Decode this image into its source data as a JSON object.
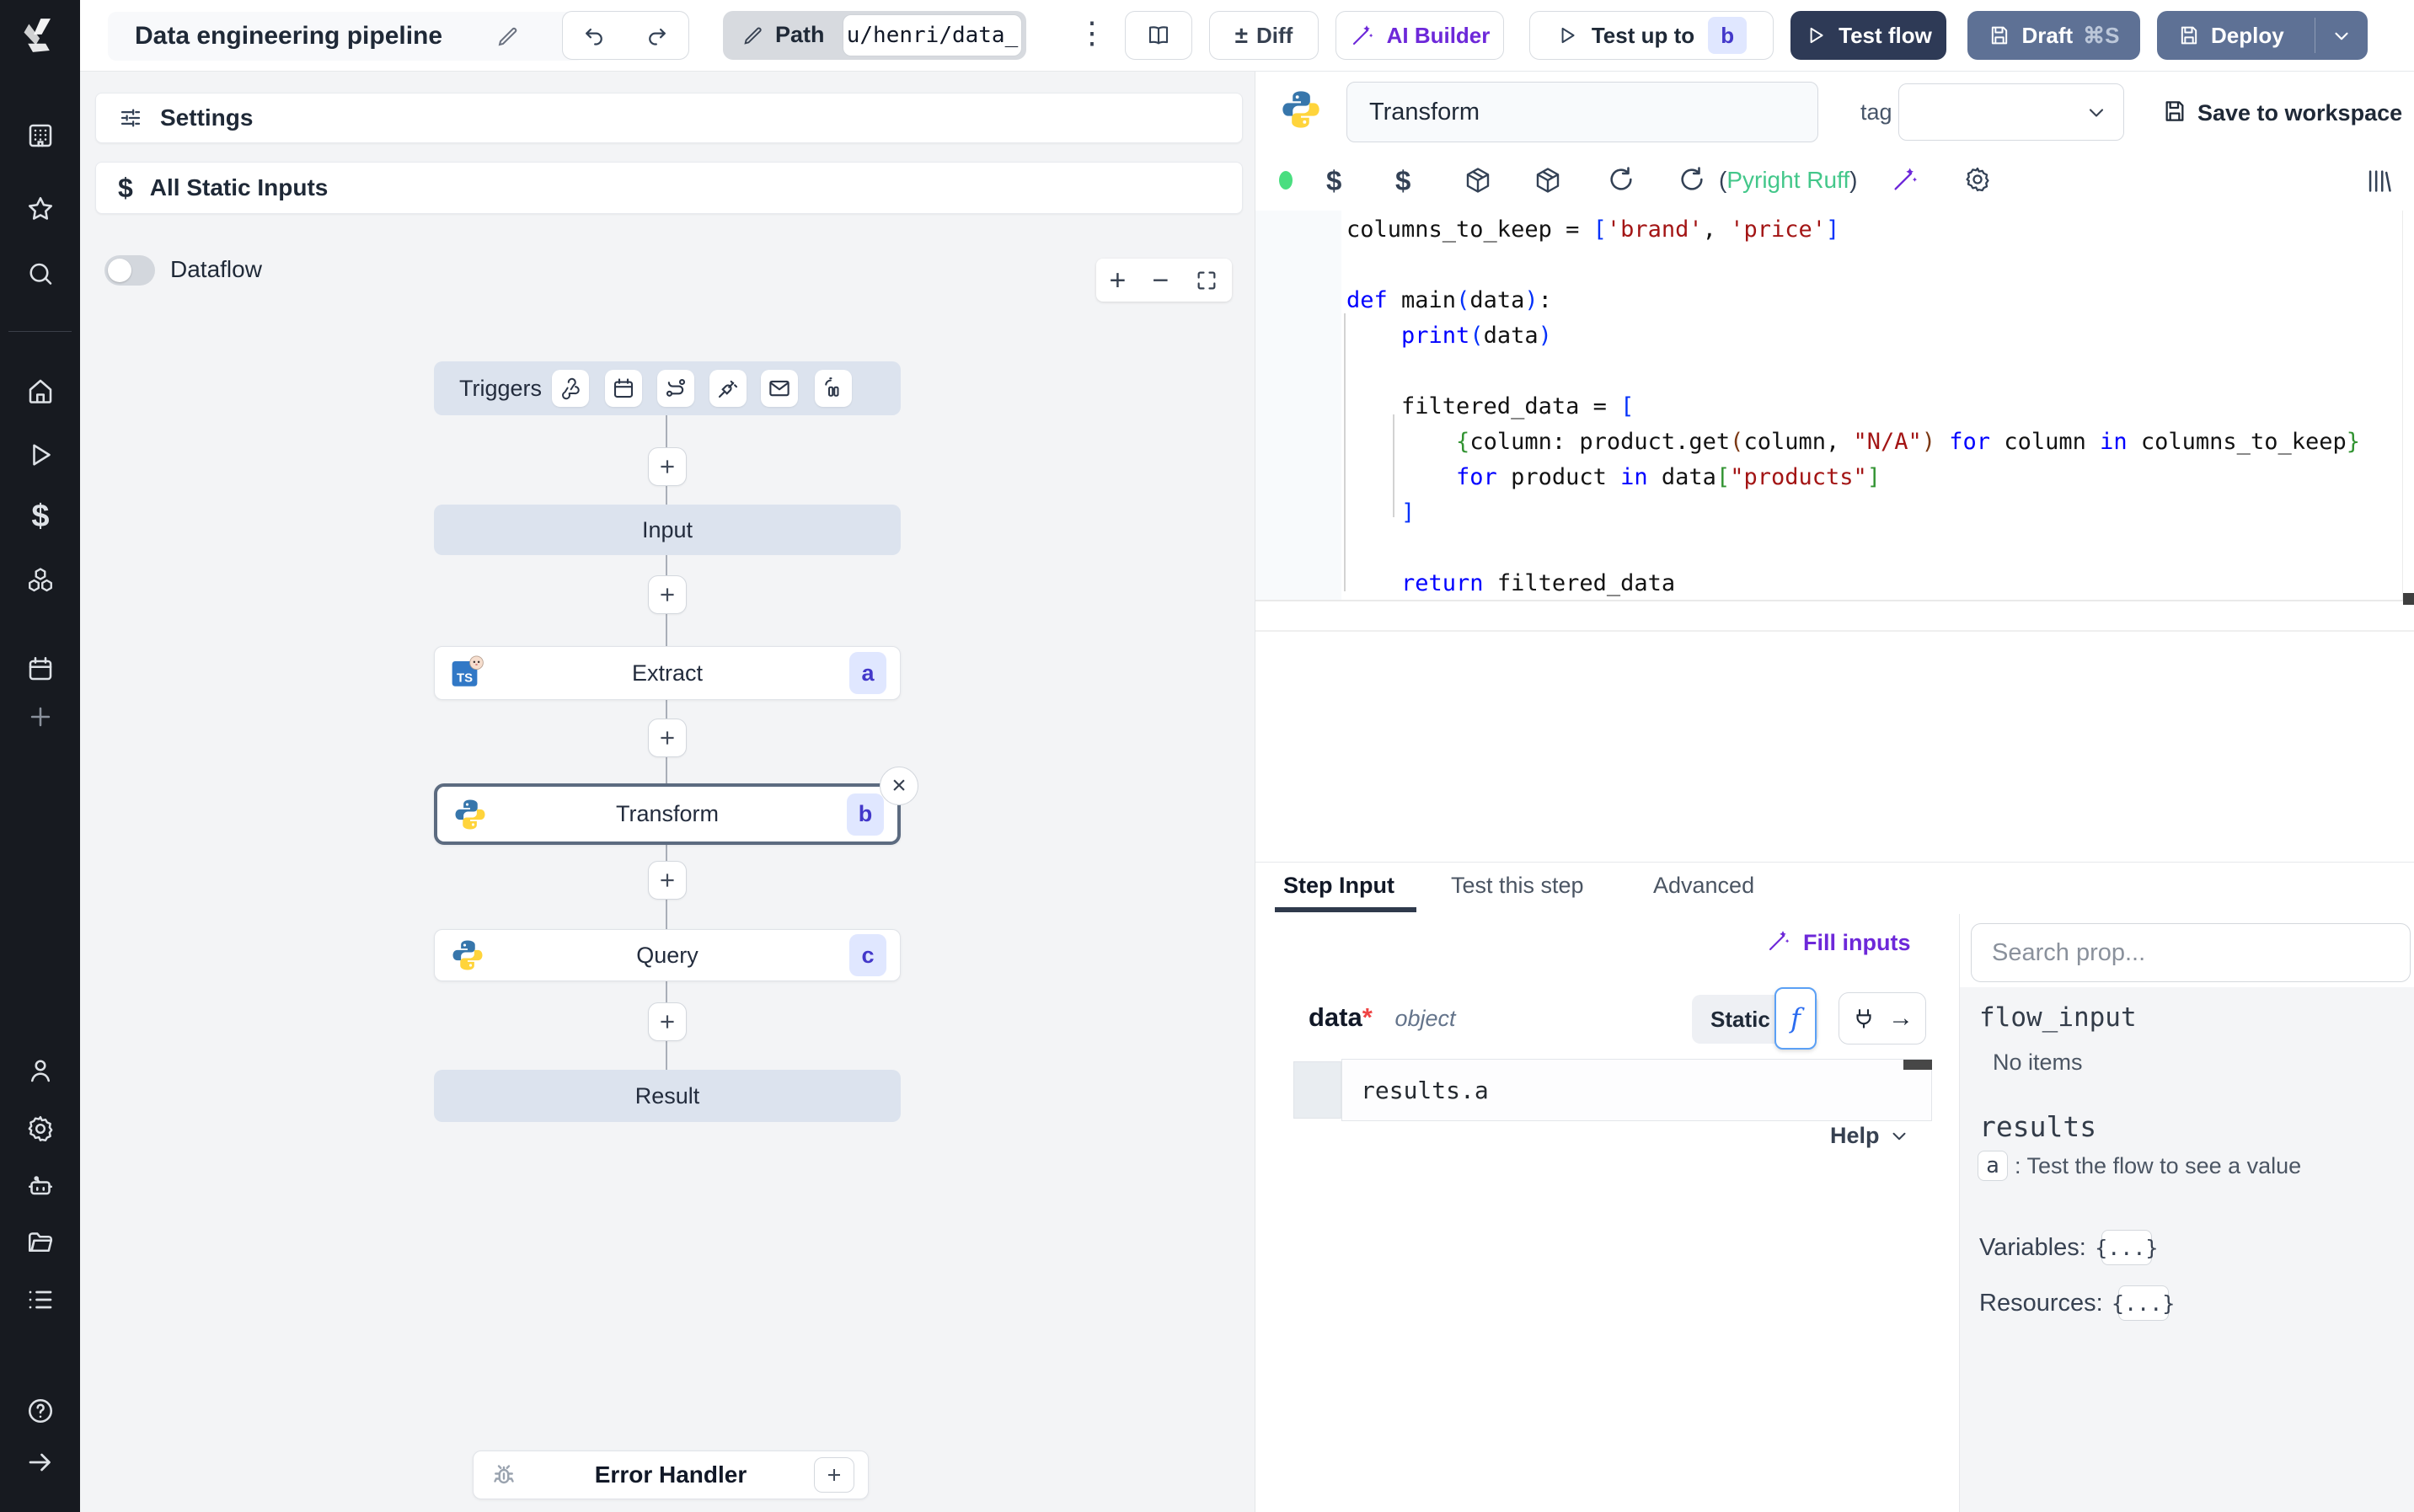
{
  "colors": {
    "accent_purple": "#6d28d9",
    "dark_button_bg": "#2e3a56",
    "slate_button_bg": "#5e7195",
    "status_green": "#4ade80",
    "lint_green": "#43c78a",
    "badge_bg": "#e0e7ff",
    "badge_text": "#4338ca",
    "selected_node_border": "#5c6b80",
    "virtual_node_bg": "#dce3ee",
    "code_keyword": "#0000ff",
    "code_string": "#a31515",
    "bracket_blue": "#0431fa",
    "bracket_green": "#319331",
    "bracket_brown": "#7b3814"
  },
  "glyphs": {
    "dollar": "$",
    "fn": "f",
    "plus": "+",
    "minus": "−",
    "plus_minus": "±",
    "close": "×",
    "kebab": "⋮",
    "arrow_right": "→"
  },
  "header": {
    "title": "Data engineering pipeline",
    "path_label": "Path",
    "path_value": "u/henri/data_",
    "diff_label": "Diff",
    "ai_builder_label": "AI Builder",
    "test_up_to_label": "Test up to",
    "test_up_to_badge": "b",
    "test_flow_label": "Test flow",
    "draft_label": "Draft",
    "draft_shortcut": "⌘S",
    "deploy_label": "Deploy"
  },
  "left_panel": {
    "settings_label": "Settings",
    "all_static_inputs_label": "All Static Inputs",
    "dataflow_label": "Dataflow"
  },
  "graph": {
    "triggers_label": "Triggers",
    "input_label": "Input",
    "extract": {
      "label": "Extract",
      "badge": "a"
    },
    "transform": {
      "label": "Transform",
      "badge": "b"
    },
    "query": {
      "label": "Query",
      "badge": "c"
    },
    "result_label": "Result",
    "error_handler_label": "Error Handler"
  },
  "editor_panel": {
    "step_name": "Transform",
    "tag_label": "tag",
    "save_to_workspace_label": "Save to workspace",
    "lint_open": "(",
    "lint_label": "Pyright Ruff",
    "lint_close": ")",
    "code_lines": [
      [
        {
          "c": "t",
          "t": "columns_to_keep = "
        },
        {
          "c": "b0",
          "t": "["
        },
        {
          "c": "s",
          "t": "'brand'"
        },
        {
          "c": "t",
          "t": ", "
        },
        {
          "c": "s",
          "t": "'price'"
        },
        {
          "c": "b0",
          "t": "]"
        }
      ],
      [],
      [
        {
          "c": "k",
          "t": "def"
        },
        {
          "c": "t",
          "t": " main"
        },
        {
          "c": "b0",
          "t": "("
        },
        {
          "c": "t",
          "t": "data"
        },
        {
          "c": "b0",
          "t": ")"
        },
        {
          "c": "t",
          "t": ":"
        }
      ],
      [
        {
          "c": "t",
          "t": "    "
        },
        {
          "c": "k",
          "t": "print"
        },
        {
          "c": "b0",
          "t": "("
        },
        {
          "c": "t",
          "t": "data"
        },
        {
          "c": "b0",
          "t": ")"
        }
      ],
      [],
      [
        {
          "c": "t",
          "t": "    filtered_data = "
        },
        {
          "c": "b0",
          "t": "["
        }
      ],
      [
        {
          "c": "t",
          "t": "        "
        },
        {
          "c": "b1",
          "t": "{"
        },
        {
          "c": "t",
          "t": "column: product.get"
        },
        {
          "c": "b2",
          "t": "("
        },
        {
          "c": "t",
          "t": "column, "
        },
        {
          "c": "s",
          "t": "\"N/A\""
        },
        {
          "c": "b2",
          "t": ")"
        },
        {
          "c": "t",
          "t": " "
        },
        {
          "c": "k",
          "t": "for"
        },
        {
          "c": "t",
          "t": " column "
        },
        {
          "c": "k",
          "t": "in"
        },
        {
          "c": "t",
          "t": " columns_to_keep"
        },
        {
          "c": "b1",
          "t": "}"
        }
      ],
      [
        {
          "c": "t",
          "t": "        "
        },
        {
          "c": "k",
          "t": "for"
        },
        {
          "c": "t",
          "t": " product "
        },
        {
          "c": "k",
          "t": "in"
        },
        {
          "c": "t",
          "t": " data"
        },
        {
          "c": "b1",
          "t": "["
        },
        {
          "c": "s",
          "t": "\"products\""
        },
        {
          "c": "b1",
          "t": "]"
        }
      ],
      [
        {
          "c": "t",
          "t": "    "
        },
        {
          "c": "b0",
          "t": "]"
        }
      ],
      [],
      [
        {
          "c": "t",
          "t": "    "
        },
        {
          "c": "k",
          "t": "return"
        },
        {
          "c": "t",
          "t": " filtered_data"
        }
      ]
    ]
  },
  "tabs": {
    "step_input": "Step Input",
    "test_this_step": "Test this step",
    "advanced": "Advanced"
  },
  "step_input": {
    "fill_inputs_label": "Fill inputs",
    "field_name": "data",
    "field_required_mark": "*",
    "field_type": "object",
    "static_label": "Static",
    "expression": "results.a",
    "help_label": "Help"
  },
  "props_panel": {
    "search_placeholder": "Search prop...",
    "flow_input_label": "flow_input",
    "no_items_label": "No items",
    "results_label": "results",
    "result_key": "a",
    "result_hint": ":  Test the flow to see a value",
    "variables_label": "Variables:",
    "variables_value": "{...}",
    "resources_label": "Resources:",
    "resources_value": "{...}"
  }
}
